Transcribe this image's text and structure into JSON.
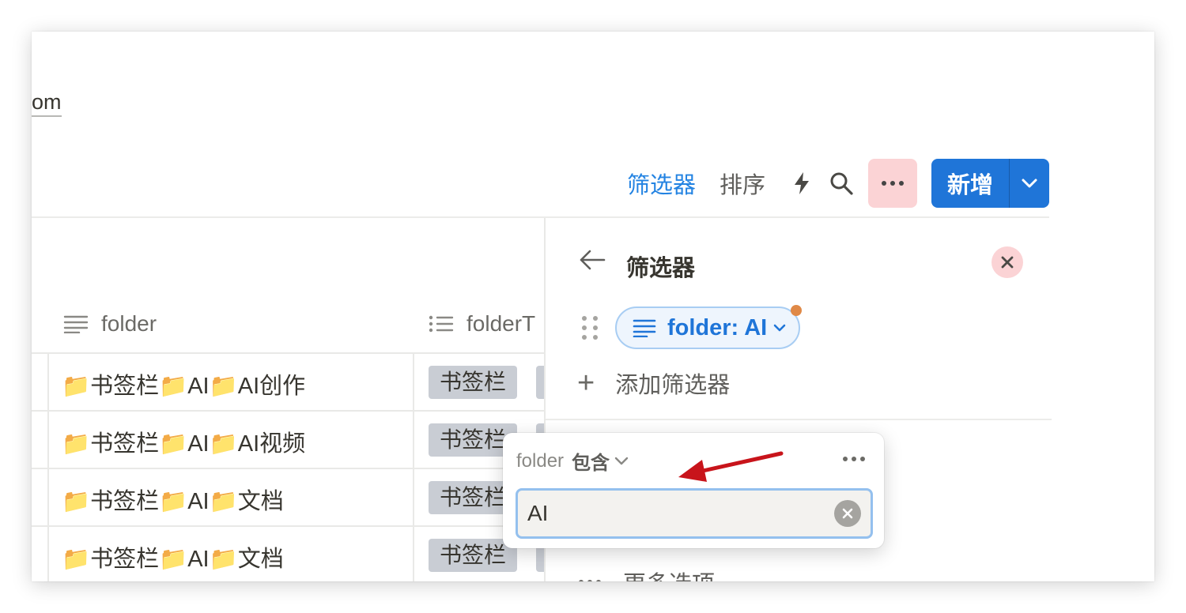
{
  "page": {
    "url_fragment": "om"
  },
  "toolbar": {
    "filter_label": "筛选器",
    "sort_label": "排序",
    "automation_icon": "lightning-icon",
    "search_icon": "search-icon",
    "more_icon": "more-horizontal-icon",
    "new_label": "新增",
    "new_dropdown_icon": "chevron-down-icon"
  },
  "table": {
    "columns": [
      {
        "label": "folder",
        "icon": "text-lines-icon"
      },
      {
        "label": "folderT",
        "icon": "list-icon"
      }
    ],
    "rows": [
      {
        "folder": "📁书签栏📁AI📁AI创作",
        "tag": "书签栏"
      },
      {
        "folder": "📁书签栏📁AI📁AI视频",
        "tag": "书签栏"
      },
      {
        "folder": "📁书签栏📁AI📁文档",
        "tag": "书签栏"
      },
      {
        "folder": "📁书签栏📁AI📁文档",
        "tag": "书签栏"
      }
    ]
  },
  "filter_panel": {
    "title": "筛选器",
    "chip_label": "folder: AI",
    "add_filter_label": "添加筛选器",
    "more_options_label": "更多选项"
  },
  "popover": {
    "property": "folder",
    "operator": "包含",
    "value": "AI"
  },
  "colors": {
    "accent": "#2383e2",
    "primary_button": "#1f75d8",
    "danger_bg": "#fbd3d5",
    "tag_bg": "#c9cdd4",
    "annotation_arrow": "#c8141b",
    "chip_dot": "#e08947"
  }
}
